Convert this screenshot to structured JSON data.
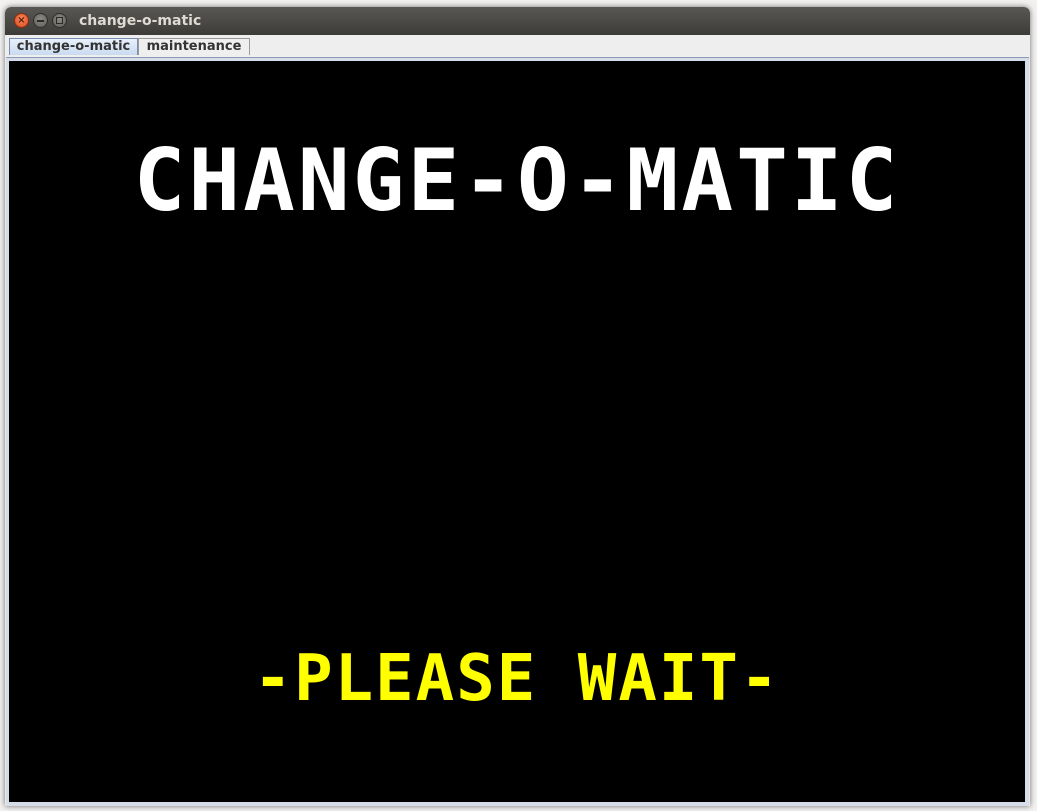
{
  "window": {
    "title": "change-o-matic"
  },
  "tabs": [
    {
      "label": "change-o-matic",
      "active": true
    },
    {
      "label": "maintenance",
      "active": false
    }
  ],
  "display": {
    "title": "CHANGE-O-MATIC",
    "status": "-PLEASE WAIT-",
    "title_color": "#ffffff",
    "status_color": "#ffff00",
    "background_color": "#000000"
  },
  "icons": {
    "close": "close-icon",
    "minimize": "minimize-icon",
    "maximize": "maximize-icon"
  }
}
